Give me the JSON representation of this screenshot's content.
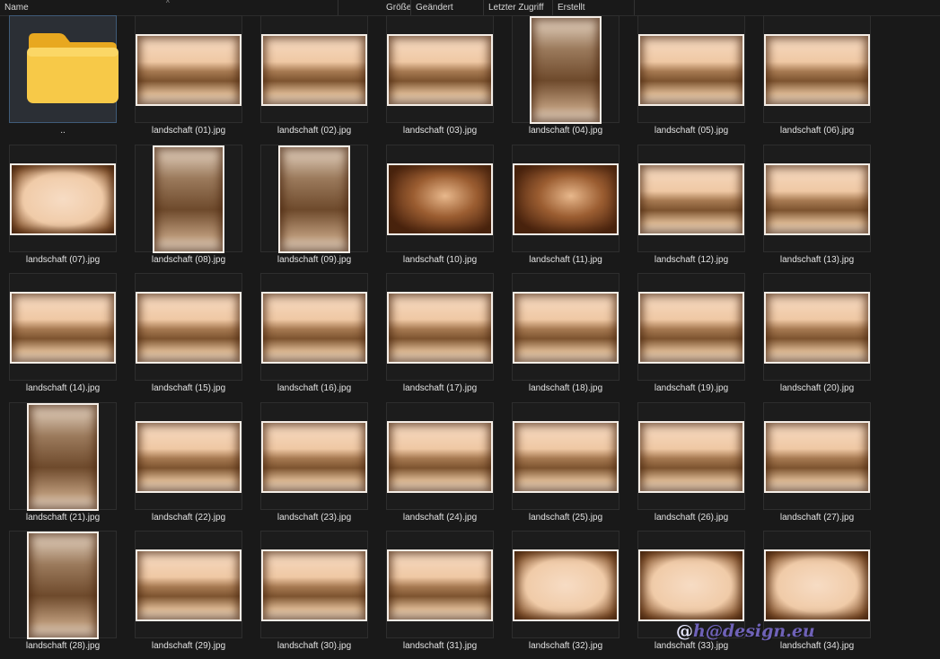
{
  "columns": {
    "name": "Name",
    "size": "Größe",
    "changed": "Geändert",
    "last_access": "Letzter Zugriff",
    "created": "Erstellt"
  },
  "items": [
    {
      "label": "..",
      "kind": "folder"
    },
    {
      "label": "landschaft (01).jpg",
      "kind": "land"
    },
    {
      "label": "landschaft (02).jpg",
      "kind": "land"
    },
    {
      "label": "landschaft (03).jpg",
      "kind": "land"
    },
    {
      "label": "landschaft (04).jpg",
      "kind": "portrait"
    },
    {
      "label": "landschaft (05).jpg",
      "kind": "land"
    },
    {
      "label": "landschaft (06).jpg",
      "kind": "land"
    },
    {
      "label": "landschaft (07).jpg",
      "kind": "frame"
    },
    {
      "label": "landschaft (08).jpg",
      "kind": "portrait"
    },
    {
      "label": "landschaft (09).jpg",
      "kind": "portrait"
    },
    {
      "label": "landschaft (10).jpg",
      "kind": "dark"
    },
    {
      "label": "landschaft (11).jpg",
      "kind": "dark"
    },
    {
      "label": "landschaft (12).jpg",
      "kind": "land"
    },
    {
      "label": "landschaft (13).jpg",
      "kind": "land"
    },
    {
      "label": "landschaft (14).jpg",
      "kind": "land"
    },
    {
      "label": "landschaft (15).jpg",
      "kind": "land"
    },
    {
      "label": "landschaft (16).jpg",
      "kind": "land"
    },
    {
      "label": "landschaft (17).jpg",
      "kind": "land"
    },
    {
      "label": "landschaft (18).jpg",
      "kind": "land"
    },
    {
      "label": "landschaft (19).jpg",
      "kind": "land"
    },
    {
      "label": "landschaft (20).jpg",
      "kind": "land"
    },
    {
      "label": "landschaft (21).jpg",
      "kind": "portrait"
    },
    {
      "label": "landschaft (22).jpg",
      "kind": "land"
    },
    {
      "label": "landschaft (23).jpg",
      "kind": "land"
    },
    {
      "label": "landschaft (24).jpg",
      "kind": "land"
    },
    {
      "label": "landschaft (25).jpg",
      "kind": "land"
    },
    {
      "label": "landschaft (26).jpg",
      "kind": "land"
    },
    {
      "label": "landschaft (27).jpg",
      "kind": "land"
    },
    {
      "label": "landschaft (28).jpg",
      "kind": "portrait"
    },
    {
      "label": "landschaft (29).jpg",
      "kind": "land"
    },
    {
      "label": "landschaft (30).jpg",
      "kind": "land"
    },
    {
      "label": "landschaft (31).jpg",
      "kind": "land"
    },
    {
      "label": "landschaft (32).jpg",
      "kind": "frame"
    },
    {
      "label": "landschaft (33).jpg",
      "kind": "frame"
    },
    {
      "label": "landschaft (34).jpg",
      "kind": "frame"
    }
  ],
  "watermark": {
    "prefix": "@",
    "brand": "h@design.eu"
  },
  "colors": {
    "background": "#191919",
    "selection": "#2b2f35",
    "folder": "#f7c948",
    "sepia": "#b07a4a",
    "watermark": "#6f62b8"
  }
}
